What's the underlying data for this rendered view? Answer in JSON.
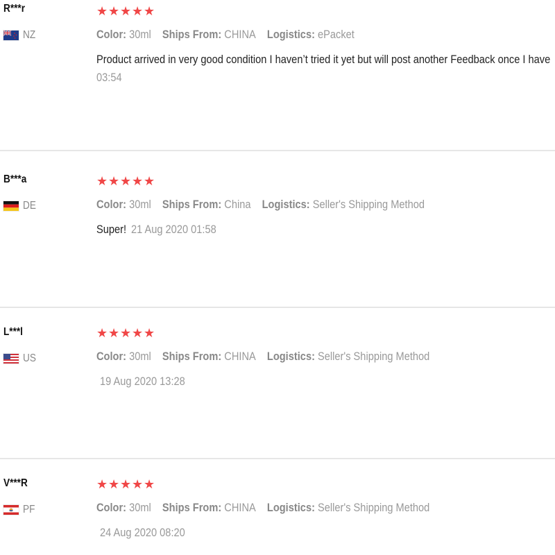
{
  "reviews": [
    {
      "user": "R***r",
      "country": "NZ",
      "flag_icon": "nz-flag-icon",
      "rating": 5,
      "color_label": "Color:",
      "color": "30ml",
      "ships_label": "Ships From:",
      "ships_from": "CHINA",
      "logistics_label": "Logistics:",
      "logistics": "ePacket",
      "text": "Product arrived in very good condition I haven’t tried it yet but will post another Feedback once I have",
      "date": "03:54"
    },
    {
      "user": "B***a",
      "country": "DE",
      "flag_icon": "de-flag-icon",
      "rating": 5,
      "color_label": "Color:",
      "color": "30ml",
      "ships_label": "Ships From:",
      "ships_from": "China",
      "logistics_label": "Logistics:",
      "logistics": "Seller's Shipping Method",
      "text": "Super!",
      "date": "21 Aug 2020 01:58"
    },
    {
      "user": "L***l",
      "country": "US",
      "flag_icon": "us-flag-icon",
      "rating": 5,
      "color_label": "Color:",
      "color": "30ml",
      "ships_label": "Ships From:",
      "ships_from": "CHINA",
      "logistics_label": "Logistics:",
      "logistics": "Seller's Shipping Method",
      "text": "",
      "date": "19 Aug 2020 13:28"
    },
    {
      "user": "V***R",
      "country": "PF",
      "flag_icon": "pf-flag-icon",
      "rating": 5,
      "color_label": "Color:",
      "color": "30ml",
      "ships_label": "Ships From:",
      "ships_from": "CHINA",
      "logistics_label": "Logistics:",
      "logistics": "Seller's Shipping Method",
      "text": "",
      "date": "24 Aug 2020 08:20"
    }
  ],
  "colors": {
    "star": "#f04747",
    "muted": "#999999",
    "divider": "#e6e6e6"
  }
}
